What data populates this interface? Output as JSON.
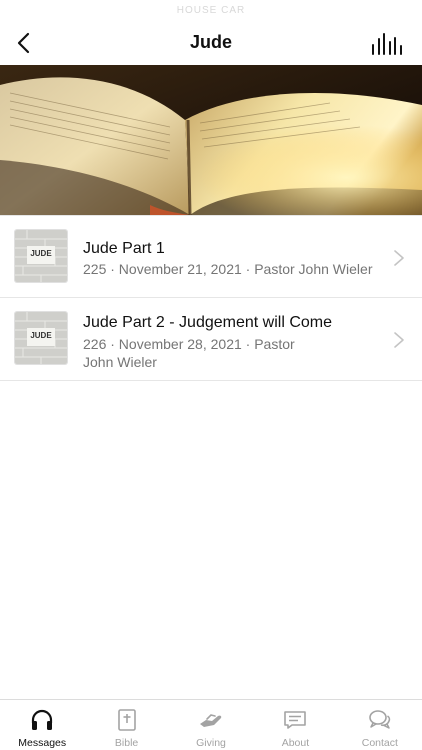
{
  "status_bar": {
    "label": "HOUSE CAR"
  },
  "nav": {
    "title": "Jude",
    "back_icon": "chevron-left-icon",
    "equalizer_icon": "equalizer-icon"
  },
  "hero": {
    "image": "open-bible-photo"
  },
  "messages": [
    {
      "title": "Jude Part 1",
      "meta_line1": "225 · November 21, 2021 · Pastor John Wieler",
      "meta_line2": "",
      "thumb_text": "JUDE"
    },
    {
      "title": "Jude Part 2 - Judgement will Come",
      "meta_line1": "226 · November 28, 2021 · Pastor",
      "meta_line2": "John Wieler",
      "thumb_text": "JUDE"
    }
  ],
  "tabs": [
    {
      "label": "Messages",
      "icon": "headphones-icon",
      "active": true
    },
    {
      "label": "Bible",
      "icon": "bible-icon",
      "active": false
    },
    {
      "label": "Giving",
      "icon": "giving-hand-icon",
      "active": false
    },
    {
      "label": "About",
      "icon": "about-card-icon",
      "active": false
    },
    {
      "label": "Contact",
      "icon": "chat-bubbles-icon",
      "active": false
    }
  ],
  "colors": {
    "active_tab": "#111111",
    "inactive_tab": "#a3a3a3",
    "meta_text": "#757575",
    "divider": "#e6e6e6"
  }
}
